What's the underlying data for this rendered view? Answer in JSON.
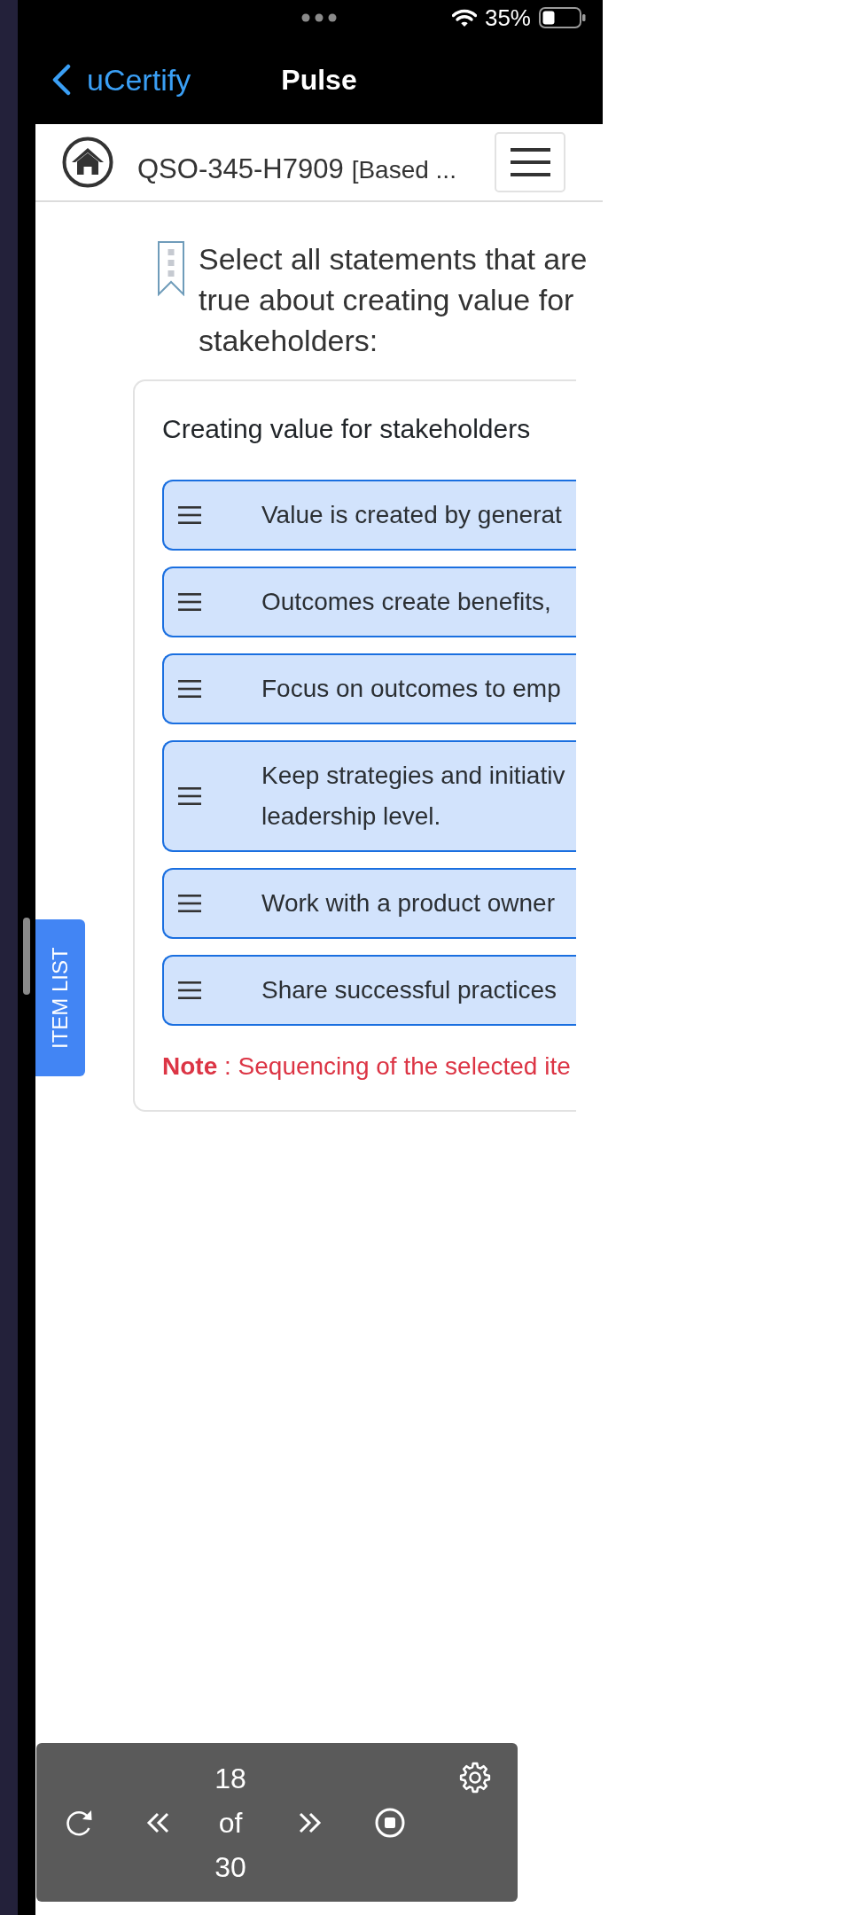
{
  "status_bar": {
    "battery": "35%"
  },
  "nav_bar": {
    "back_label": "uCertify",
    "title": "Pulse"
  },
  "header": {
    "course_code": "QSO-345-H7909",
    "course_subtitle": "[Based ..."
  },
  "question": {
    "prompt": "Select all statements that are true about creating value for stakeholders:"
  },
  "card": {
    "title": "Creating value for stakeholders",
    "items": [
      {
        "lines": [
          "Value is created by generat"
        ]
      },
      {
        "lines": [
          "Outcomes create benefits,"
        ]
      },
      {
        "lines": [
          "Focus on outcomes to emp"
        ]
      },
      {
        "lines": [
          "Keep strategies and initiativ",
          "leadership level."
        ]
      },
      {
        "lines": [
          "Work with a product owner"
        ]
      },
      {
        "lines": [
          "Share successful practices"
        ]
      }
    ],
    "note": "**Note** : Sequencing of the selected ite"
  },
  "side_tab": {
    "label": "ITEM LIST"
  },
  "toolbar": {
    "current": "18",
    "separator": "of",
    "total": "30"
  }
}
